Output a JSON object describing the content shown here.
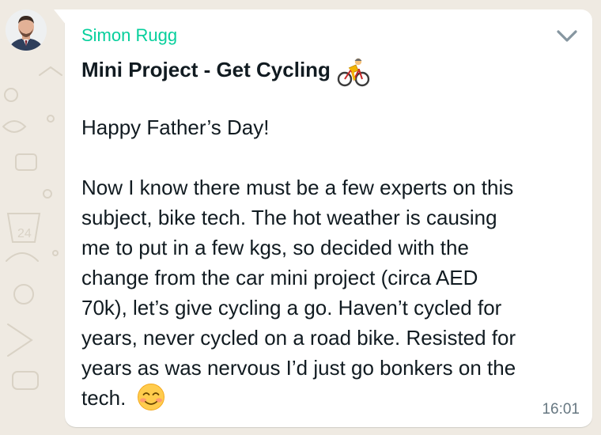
{
  "colors": {
    "wallpaper": "#efeae2",
    "bubble": "#ffffff",
    "sender_name": "#06cf9c",
    "text": "#111b21",
    "timestamp": "#667781"
  },
  "message": {
    "sender": "Simon Rugg",
    "title": "Mini Project - Get Cycling",
    "title_emoji": "person-cycling-emoji",
    "greeting": "Happy Father’s Day!",
    "body_lines": [
      "Now I know there must be a few experts on this",
      "subject, bike tech. The hot weather is causing",
      "me to put in a few kgs, so decided with the",
      "change from the car mini project (circa AED",
      "70k), let’s give cycling a go. Haven’t cycled for",
      "years, never cycled on a road bike. Resisted for",
      "years as was nervous I’d just go bonkers on the",
      "tech."
    ],
    "end_emoji": "smiling-face-emoji",
    "time": "16:01"
  },
  "icons": {
    "menu": "chevron-down-icon",
    "avatar": "avatar"
  }
}
